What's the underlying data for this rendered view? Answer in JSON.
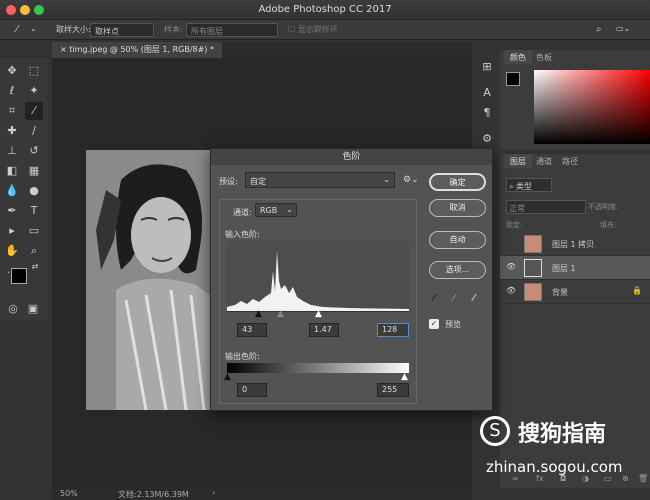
{
  "app": {
    "title": "Adobe Photoshop CC 2017"
  },
  "options_bar": {
    "sample_size_label": "取样大小:",
    "sample_size_value": "取样点",
    "sample_label": "样本:",
    "sample_value": "所有图层",
    "show_ring_label": "显示取样环"
  },
  "document": {
    "tab_title": "timg.jpeg @ 50% (图层 1, RGB/8#) *"
  },
  "status": {
    "zoom": "50%",
    "doc_size": "文档:2.13M/6.39M"
  },
  "color_panel": {
    "tabs": [
      "颜色",
      "色板"
    ]
  },
  "layers_panel": {
    "tabs": [
      "图层",
      "通道",
      "路径"
    ],
    "kind_label": "类型",
    "blend_mode": "正常",
    "opacity_label": "不透明度:",
    "lock_label": "锁定:",
    "fill_label": "填充:",
    "layers": [
      {
        "name": "图层 1 拷贝",
        "visible": false
      },
      {
        "name": "图层 1",
        "visible": true,
        "selected": true
      },
      {
        "name": "背景",
        "visible": true,
        "locked": true
      }
    ]
  },
  "levels_dialog": {
    "title": "色阶",
    "preset_label": "预设:",
    "preset_value": "自定",
    "channel_label": "通道:",
    "channel_value": "RGB",
    "input_label": "输入色阶:",
    "output_label": "输出色阶:",
    "input_black": "43",
    "input_gamma": "1.47",
    "input_white": "128",
    "output_black": "0",
    "output_white": "255",
    "buttons": {
      "ok": "确定",
      "cancel": "取消",
      "auto": "自动",
      "options": "选项..."
    },
    "preview_label": "预览",
    "preview_checked": true
  },
  "watermark": {
    "brand": "搜狗指南",
    "url": "zhinan.sogou.com"
  },
  "colors": {
    "accent_blue": "#4a90d9",
    "foreground": "#000000",
    "background": "#ffffff"
  }
}
